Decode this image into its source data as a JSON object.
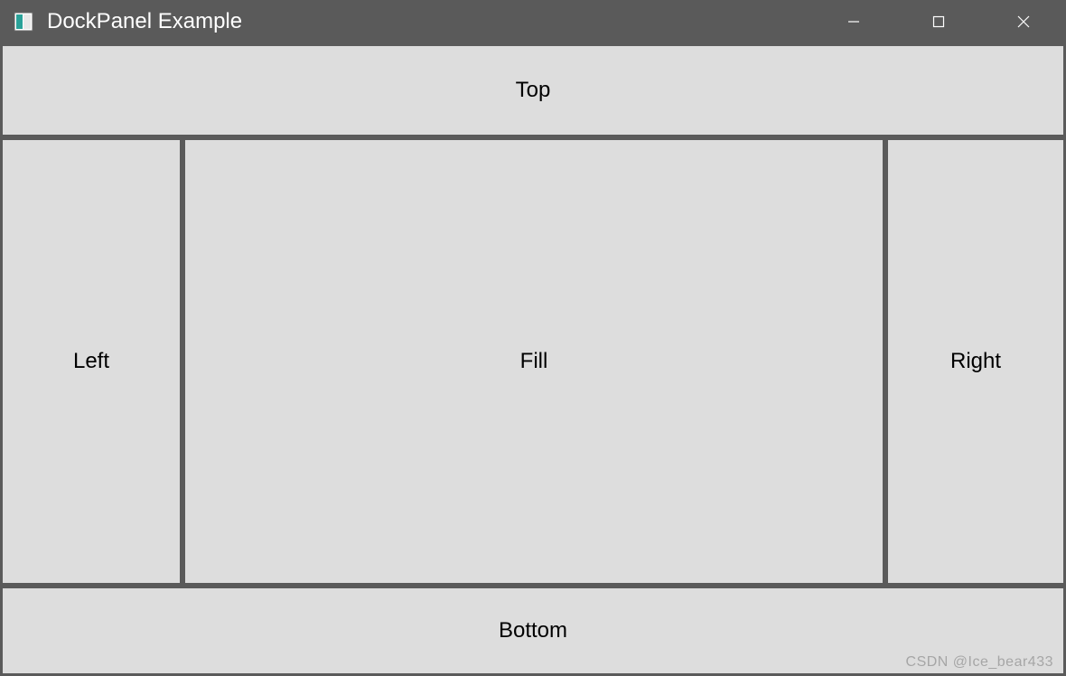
{
  "window": {
    "title": "DockPanel Example"
  },
  "panels": {
    "top": "Top",
    "left": "Left",
    "fill": "Fill",
    "right": "Right",
    "bottom": "Bottom"
  },
  "watermark": "CSDN @Ice_bear433"
}
